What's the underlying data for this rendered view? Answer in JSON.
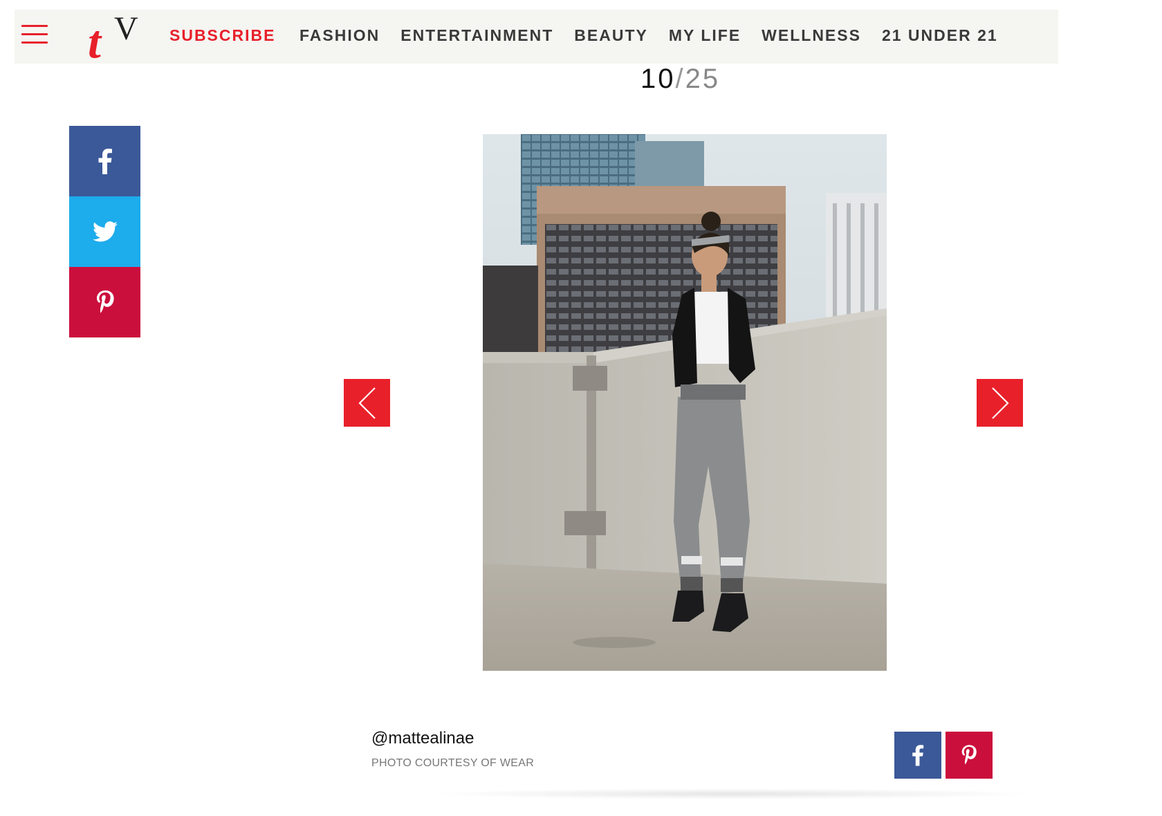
{
  "header": {
    "menu_icon": "hamburger-menu-icon",
    "logo_t": "t",
    "logo_v": "V",
    "subscribe_label": "SUBSCRIBE",
    "nav": [
      "FASHION",
      "ENTERTAINMENT",
      "BEAUTY",
      "MY LIFE",
      "WELLNESS",
      "21 UNDER 21"
    ]
  },
  "gallery": {
    "current": "10",
    "separator": "/",
    "total": "25",
    "prev_icon": "chevron-left-icon",
    "next_icon": "chevron-right-icon",
    "photo_alt": "Woman in black blazer, white top and grey jogger sweatpants standing on a rooftop parking deck"
  },
  "caption": {
    "handle": "@mattealinae",
    "credit": "PHOTO COURTESY OF WEAR"
  },
  "share": {
    "rail": [
      "facebook-icon",
      "twitter-icon",
      "pinterest-icon"
    ],
    "bottom": [
      "facebook-icon",
      "pinterest-icon"
    ]
  },
  "colors": {
    "brand_red": "#e8202a",
    "facebook": "#3b5998",
    "twitter": "#1dacec",
    "pinterest": "#cb0f3c",
    "nav_bg": "#f5f5f2"
  }
}
